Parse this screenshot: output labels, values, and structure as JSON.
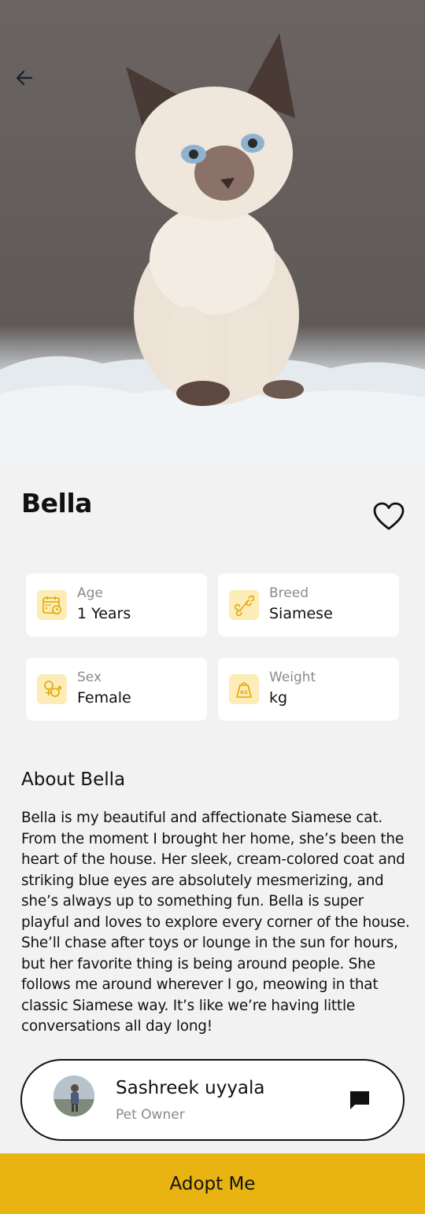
{
  "pet": {
    "name": "Bella",
    "photo": "siamese-kitten-photo"
  },
  "info_cards": [
    {
      "label": "Age",
      "value": "1 Years",
      "icon": "calendar-icon"
    },
    {
      "label": "Breed",
      "value": "Siamese",
      "icon": "bone-icon"
    },
    {
      "label": "Sex",
      "value": "Female",
      "icon": "gender-icon"
    },
    {
      "label": "Weight",
      "value": "kg",
      "icon": "weight-icon"
    }
  ],
  "about": {
    "title": "About Bella",
    "text": "Bella is my beautiful and affectionate Siamese cat. From the moment I brought her home, she’s been the heart of the house. Her sleek, cream-colored coat and striking blue eyes are absolutely mesmerizing, and she’s always up to something fun.  Bella is super playful and loves to explore every corner of the house. She’ll chase after toys or lounge in the sun for hours, but her favorite thing is being around people. She follows me around wherever I go, meowing in that classic Siamese way. It’s like we’re having little conversations all day long!"
  },
  "owner": {
    "name": "Sashreek uyyala",
    "role": "Pet Owner"
  },
  "actions": {
    "adopt_label": "Adopt Me"
  },
  "colors": {
    "accent": "#e9b311",
    "icon_bg": "#fdecb7",
    "icon_stroke": "#e0a800",
    "background": "#f2f2f2"
  }
}
